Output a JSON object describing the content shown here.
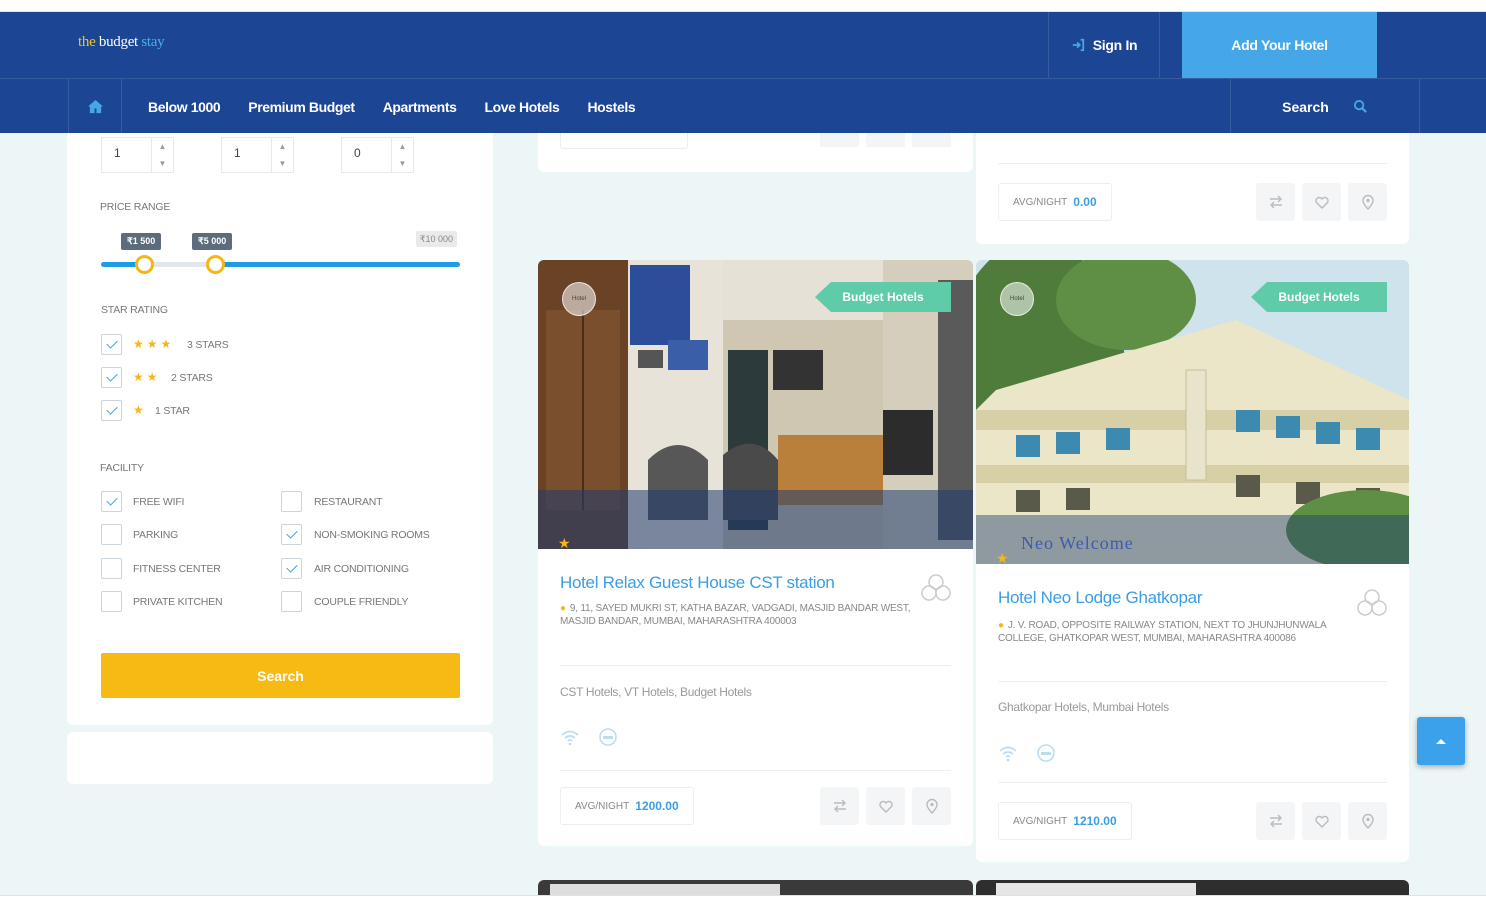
{
  "header": {
    "logo": {
      "part1": "the",
      "part2": " budget ",
      "part3": "stay"
    },
    "signin_label": "Sign In",
    "add_hotel_label": "Add Your Hotel",
    "nav": [
      "Below 1000",
      "Premium Budget",
      "Apartments",
      "Love Hotels",
      "Hostels"
    ],
    "search_label": "Search"
  },
  "sidebar": {
    "steppers": [
      "1",
      "1",
      "0"
    ],
    "price_range_label": "PRICE RANGE",
    "price_min": "₹1 500",
    "price_max_sel": "₹5 000",
    "price_max": "₹10 000",
    "slider_min_fraction": 0.12,
    "slider_max_fraction": 0.32,
    "star_rating_label": "STAR RATING",
    "star_options": [
      {
        "stars": "★★★",
        "label": "3 STARS",
        "checked": true
      },
      {
        "stars": "★★",
        "label": "2 STARS",
        "checked": true
      },
      {
        "stars": "★",
        "label": "1 STAR",
        "checked": true
      }
    ],
    "facility_label": "FACILITY",
    "facilities_left": [
      {
        "label": "FREE WIFI",
        "checked": true
      },
      {
        "label": "PARKING",
        "checked": false
      },
      {
        "label": "FITNESS CENTER",
        "checked": false
      },
      {
        "label": "PRIVATE KITCHEN",
        "checked": false
      }
    ],
    "facilities_right": [
      {
        "label": "RESTAURANT",
        "checked": false
      },
      {
        "label": "NON-SMOKING ROOMS",
        "checked": true
      },
      {
        "label": "AIR CONDITIONING",
        "checked": true
      },
      {
        "label": "COUPLE FRIENDLY",
        "checked": false
      }
    ],
    "search_button": "Search"
  },
  "cards": [
    {
      "badge": "Budget Hotels",
      "avatar": "Hotel",
      "name": "Hotel Relax Guest House CST station",
      "address": "9, 11, SAYED MUKRI ST, KATHA BAZAR, VADGADI, MASJID BANDAR WEST, MASJID BANDAR, MUMBAI, MAHARASHTRA 400003",
      "tags": "CST Hotels, VT Hotels, Budget Hotels",
      "price_label": "AVG/NIGHT",
      "price": "1200.00"
    },
    {
      "badge": "Budget Hotels",
      "avatar": "Hotel",
      "name": "Hotel Neo Lodge Ghatkopar",
      "address": "J. V. ROAD, OPPOSITE RAILWAY STATION, NEXT TO JHUNJHUNWALA COLLEGE, GHATKOPAR WEST, MUMBAI, MAHARASHTRA 400086",
      "tags": "Ghatkopar Hotels, Mumbai Hotels",
      "price_label": "AVG/NIGHT",
      "price": "1210.00",
      "sign_text": "Neo Welcome"
    }
  ],
  "top_right_card": {
    "price_label": "AVG/NIGHT",
    "price": "0.00"
  },
  "colors": {
    "header": "#1c4593",
    "accent": "#45a6e8",
    "search": "#f7b913",
    "badge": "#5fcba8"
  }
}
